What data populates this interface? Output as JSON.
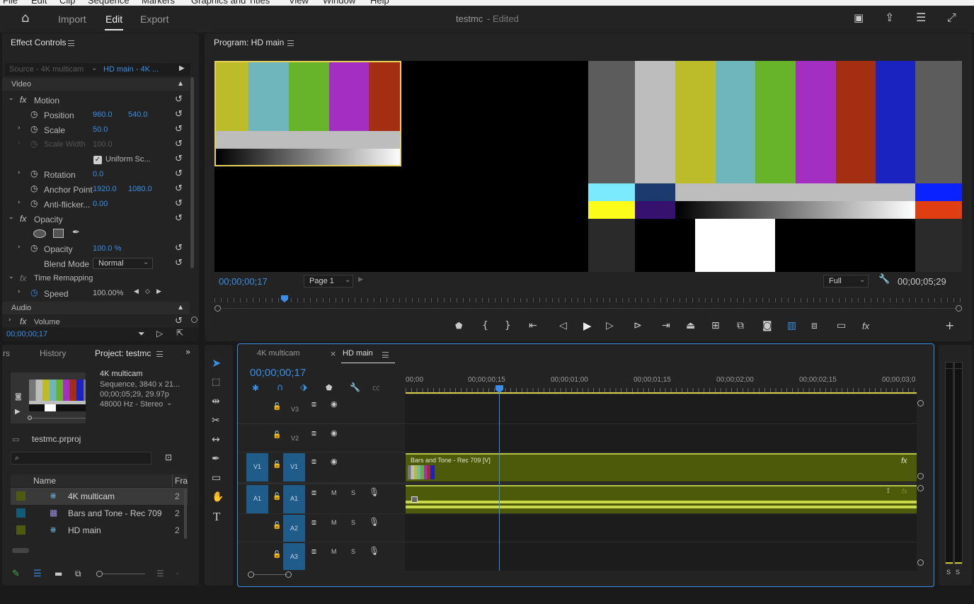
{
  "menu": [
    "File",
    "Edit",
    "Clip",
    "Sequence",
    "Markers",
    "Graphics and Titles",
    "View",
    "Window",
    "Help"
  ],
  "header": {
    "tabs": {
      "import": "Import",
      "edit": "Edit",
      "export": "Export"
    },
    "project_name": "testmc",
    "edited": "- Edited"
  },
  "effect_controls": {
    "title": "Effect Controls",
    "source": "Source - 4K multicam",
    "target": "HD main - 4K ...",
    "video_label": "Video",
    "motion": "Motion",
    "position": {
      "label": "Position",
      "x": "960.0",
      "y": "540.0"
    },
    "scale": {
      "label": "Scale",
      "value": "50.0"
    },
    "scale_width": {
      "label": "Scale Width",
      "value": "100.0"
    },
    "uniform_scale": "Uniform Sc...",
    "rotation": {
      "label": "Rotation",
      "value": "0.0"
    },
    "anchor": {
      "label": "Anchor Point",
      "x": "1920.0",
      "y": "1080.0"
    },
    "antiflicker": {
      "label": "Anti-flicker...",
      "value": "0.00"
    },
    "opacity_group": "Opacity",
    "opacity": {
      "label": "Opacity",
      "value": "100.0 %"
    },
    "blend": {
      "label": "Blend Mode",
      "value": "Normal"
    },
    "time_remap": "Time Remapping",
    "speed": {
      "label": "Speed",
      "value": "100.00%"
    },
    "audio_label": "Audio",
    "volume": "Volume",
    "timecode": "00;00;00;17"
  },
  "program": {
    "title": "Program: HD main",
    "timecode": "00;00;00;17",
    "page": "Page 1",
    "quality": "Full",
    "duration": "00;00;05;29"
  },
  "project": {
    "tabs": {
      "markers": "rs",
      "history": "History",
      "project": "Project: testmc"
    },
    "clip_name": "4K multicam",
    "clip_line1": "Sequence, 3840 x 21...",
    "clip_line2": "00;00;05;29, 29.97p",
    "clip_line3": "48000 Hz - Stereo",
    "file": "testmc.prproj",
    "search_placeholder": "",
    "col_name": "Name",
    "col_fra": "Fra",
    "items": [
      {
        "name": "4K multicam",
        "color": "#4d5a12",
        "fr": "2"
      },
      {
        "name": "Bars and Tone - Rec 709",
        "color": "#145b78",
        "fr": "2"
      },
      {
        "name": "HD main",
        "color": "#4d5a12",
        "fr": "2"
      }
    ]
  },
  "timeline": {
    "tab1": "4K multicam",
    "tab2": "HD main",
    "timecode": "00;00;00;17",
    "ruler": [
      "00;00",
      "00;00;00;15",
      "00;00;01;00",
      "00;00;01;15",
      "00;00;02;00",
      "00;00;02;15",
      "00;00;03;0"
    ],
    "tracks": {
      "v3": "V3",
      "v2": "V2",
      "v1": "V1",
      "a1": "A1",
      "a2": "A2",
      "a3": "A3",
      "src_v1": "V1",
      "src_a1": "A1"
    },
    "clip_v": "Bars and Tone - Rec 709 [V]",
    "m": "M",
    "s": "S",
    "fx": "fx"
  },
  "meters": {
    "s1": "S",
    "s2": "S"
  },
  "colors": {
    "accent": "#3a8ee6",
    "clip": "#5a6b0a",
    "selected_track": "#1f5c8a",
    "playhead": "#3a8ee6"
  }
}
